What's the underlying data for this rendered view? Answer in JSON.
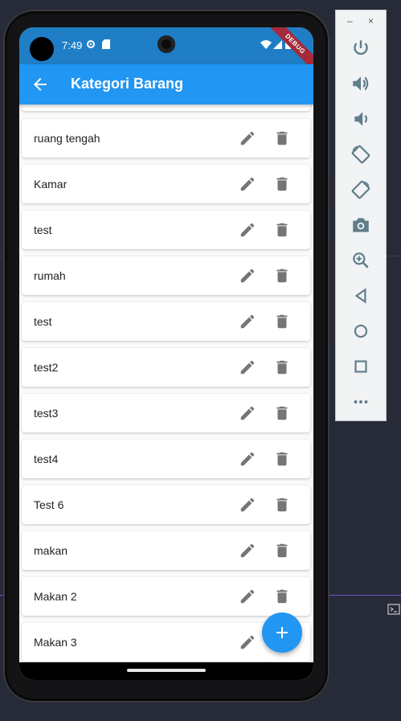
{
  "status_bar": {
    "time": "7:49",
    "debug_banner": "DEBUG"
  },
  "app_bar": {
    "title": "Kategori Barang"
  },
  "categories": [
    "ruang tengah",
    "Kamar",
    "test",
    "rumah",
    "test",
    "test2",
    "test3",
    "test4",
    "Test 6",
    "makan",
    "Makan 2",
    "Makan 3"
  ],
  "colors": {
    "app_bar": "#2196f3",
    "status_bar": "#1f7ec6",
    "fab": "#2196f3",
    "icon_grey": "#757575",
    "debug_banner": "#a52a3a"
  },
  "emulator_toolbar": {
    "minimize": "–",
    "close": "×",
    "buttons": [
      "power-icon",
      "volume-up-icon",
      "volume-down-icon",
      "rotate-left-icon",
      "rotate-right-icon",
      "camera-icon",
      "zoom-icon",
      "back-triangle-icon",
      "home-circle-icon",
      "overview-square-icon",
      "more-icon"
    ]
  }
}
